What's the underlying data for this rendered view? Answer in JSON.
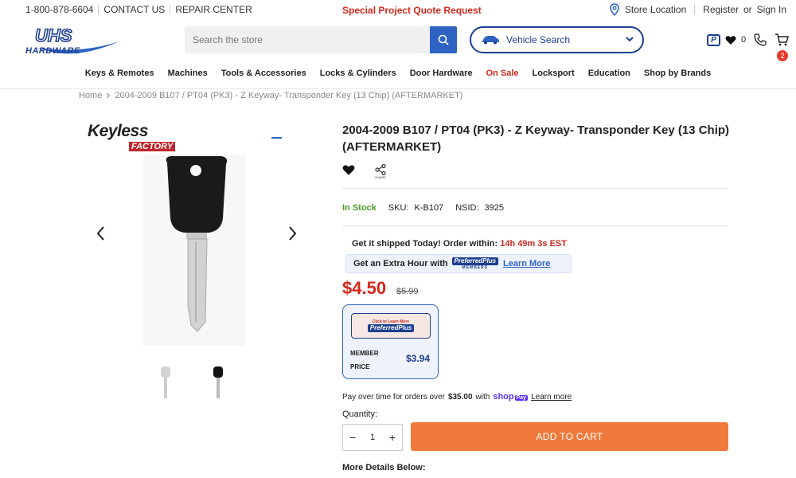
{
  "topbar": {
    "phone": "1-800-878-6604",
    "contact": "CONTACT US",
    "repair": "REPAIR CENTER",
    "promo": "Special Project Quote Request",
    "store_location": "Store Location",
    "register": "Register",
    "or": "or",
    "sign_in": "Sign In"
  },
  "header": {
    "logo_top": "UHS",
    "logo_bottom": "HARDWARE",
    "search_placeholder": "Search the store",
    "vehicle_search": "Vehicle Search",
    "wishlist_count": "0",
    "pp_badge": "P",
    "cart_count": "2"
  },
  "nav": {
    "items": [
      "Keys & Remotes",
      "Machines",
      "Tools & Accessories",
      "Locks & Cylinders",
      "Door Hardware",
      "On Sale",
      "Locksport",
      "Education",
      "Shop by Brands"
    ]
  },
  "breadcrumb": {
    "home": "Home",
    "current": "2004-2009 B107 / PT04 (PK3) - Z Keyway- Transponder Key (13 Chip) (AFTERMARKET)"
  },
  "gallery": {
    "brand_top": "Keyless",
    "brand_bottom": "FACTORY"
  },
  "product": {
    "title": "2004-2009 B107 / PT04 (PK3) - Z Keyway- Transponder Key (13 Chip) (AFTERMARKET)",
    "share": "SHARE",
    "stock": "In Stock",
    "sku_label": "SKU:",
    "sku": "K-B107",
    "nsid_label": "NSID:",
    "nsid": "3925",
    "ship_text": "Get it shipped Today! Order within:",
    "ship_time": "14h 49m 3s EST",
    "extra_text": "Get an Extra Hour with",
    "pp_name": "PreferredPlus",
    "pp_members": "MEMBERS",
    "learn_more": "Learn More",
    "price": "$4.50",
    "was_price": "$5.99",
    "member_click": "Click to Learn More",
    "member_label_1": "MEMBER",
    "member_label_2": "PRICE",
    "member_price": "$3.94",
    "pay_over_1": "Pay over time for orders over",
    "pay_over_amount": "$35.00",
    "pay_over_with": "with",
    "shop": "shop",
    "pay": "Pay",
    "pay_learn": "Learn more",
    "quantity_label": "Quantity:",
    "quantity": "1",
    "add_to_cart": "ADD TO CART",
    "more_details": "More Details Below:"
  }
}
